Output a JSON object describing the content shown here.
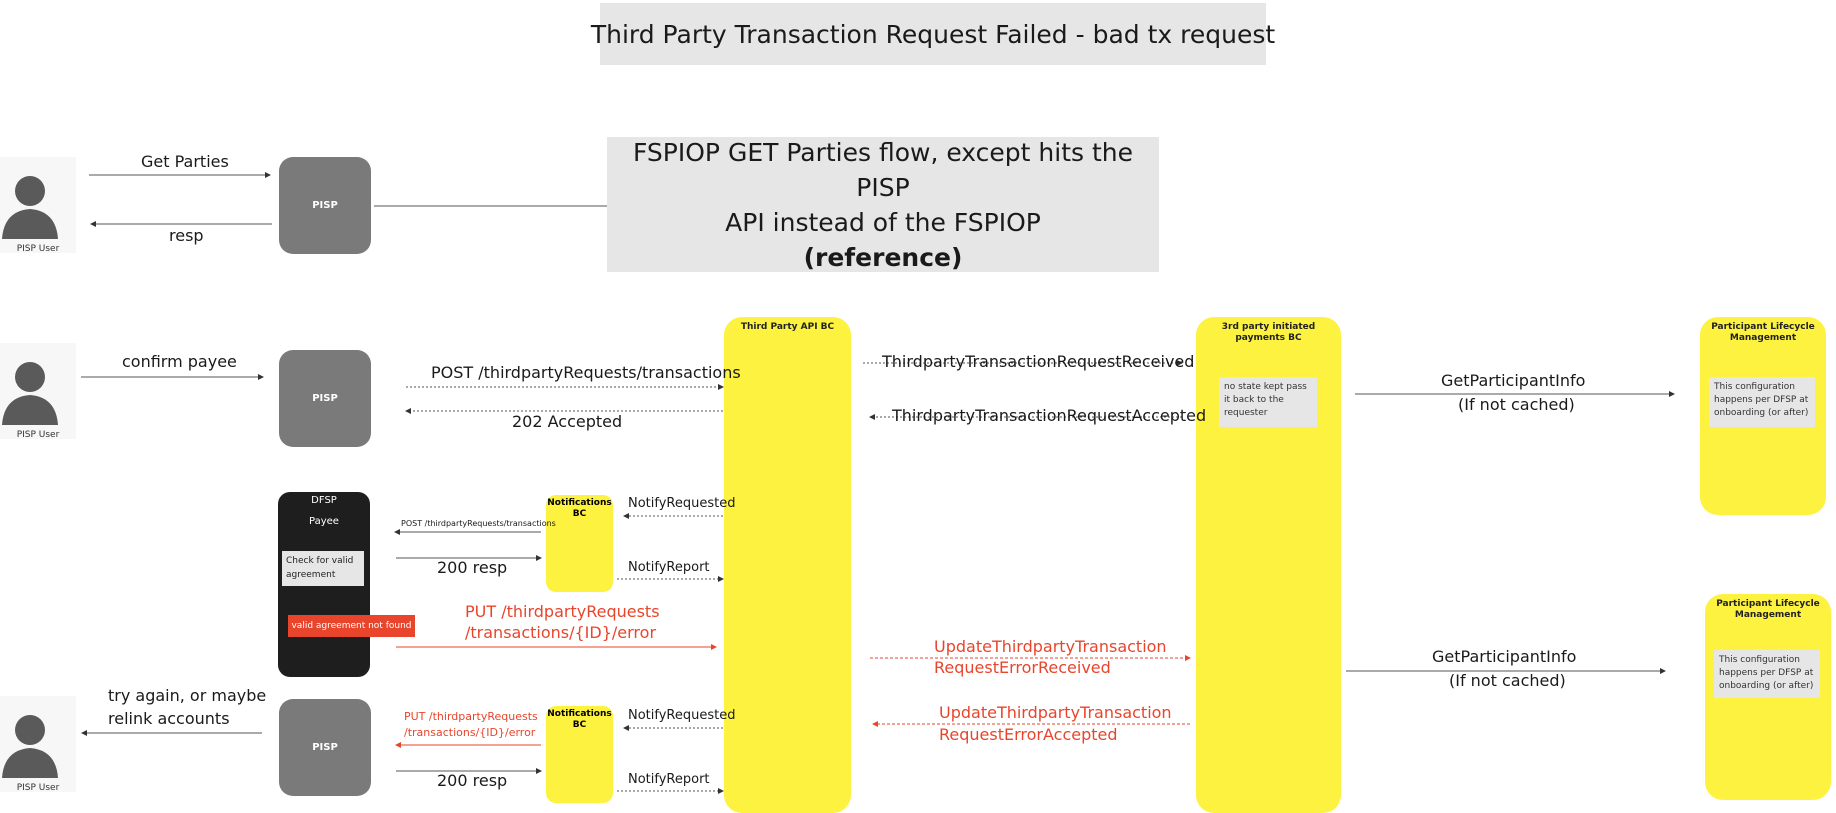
{
  "title": "Third Party Transaction Request Failed - bad tx request",
  "reference_box": {
    "line1": "FSPIOP GET Parties flow, except hits the PISP",
    "line2": "API instead of the FSPIOP",
    "line3": "(reference)"
  },
  "actors": {
    "pisp_user_label": "PISP User",
    "pisp_label": "PISP",
    "dfsp_label": "DFSP",
    "payee_label": "Payee",
    "check_note": "Check for valid agreement",
    "error_badge": "valid agreement not found",
    "notifications_bc": "Notifications BC",
    "third_party_api_bc": "Third Party API BC",
    "third_party_payments_bc": "3rd party initiated payments BC",
    "participant_lifecycle": "Participant Lifecycle Management",
    "no_state_note": "no state kept pass it back to the requester",
    "config_note": "This configuration happens per DFSP at onboarding (or after)"
  },
  "messages": {
    "get_parties": "Get Parties",
    "resp": "resp",
    "confirm_payee": "confirm payee",
    "post_transactions": "POST /thirdpartyRequests/transactions",
    "accepted_202": "202 Accepted",
    "tx_request_received": "ThirdpartyTransactionRequestReceived",
    "tx_request_accepted": "ThirdpartyTransactionRequestAccepted",
    "get_participant_info": "GetParticipantInfo",
    "if_not_cached": "(If not cached)",
    "notify_requested": "NotifyRequested",
    "notify_report": "NotifyReport",
    "post_transactions_small": "POST /thirdpartyRequests/transactions",
    "resp_200": "200 resp",
    "put_error_line1": "PUT /thirdpartyRequests",
    "put_error_line2": "/transactions/{ID}/error",
    "update_error_received_1": "UpdateThirdpartyTransaction",
    "update_error_received_2": "RequestErrorReceived",
    "update_error_accepted_1": "UpdateThirdpartyTransaction",
    "update_error_accepted_2": "RequestErrorAccepted",
    "try_again_1": "try again, or maybe",
    "try_again_2": "relink accounts"
  },
  "colors": {
    "yellow": "#fdf23f",
    "error_red": "#e8452c",
    "pisp_gray": "#7a7a7a",
    "dfsp_black": "#1e1e1e",
    "note_gray": "#e6e6e6"
  }
}
